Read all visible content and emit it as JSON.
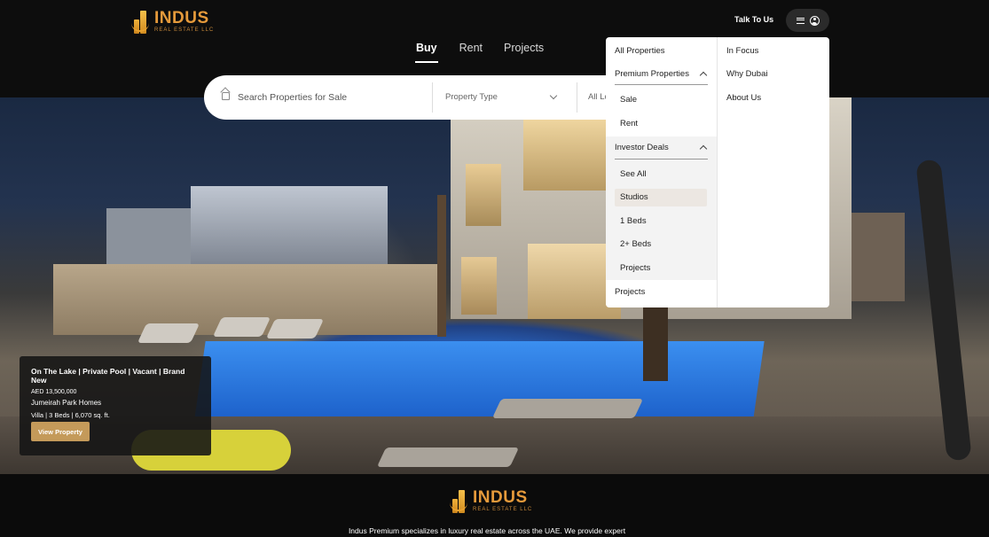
{
  "brand": {
    "name": "INDUS",
    "subtitle": "REAL ESTATE LLC"
  },
  "header": {
    "talk_label": "Talk To Us",
    "menu_icon": "hamburger-icon",
    "user_icon": "user-circle-icon"
  },
  "tabs": [
    {
      "label": "Buy",
      "active": true
    },
    {
      "label": "Rent",
      "active": false
    },
    {
      "label": "Projects",
      "active": false
    }
  ],
  "search": {
    "placeholder": "Search Properties for Sale",
    "property_type": "Property Type",
    "location": "All Locations"
  },
  "menu": {
    "all_properties": "All Properties",
    "premium": {
      "label": "Premium Properties",
      "items": [
        "Sale",
        "Rent"
      ]
    },
    "investor": {
      "label": "Investor Deals",
      "items": [
        "See All",
        "Studios",
        "1 Beds",
        "2+ Beds",
        "Projects"
      ],
      "highlighted": "Studios"
    },
    "projects": "Projects",
    "right": [
      "In Focus",
      "Why Dubai",
      "About Us"
    ]
  },
  "card": {
    "title": "On The Lake | Private Pool | Vacant | Brand New",
    "price": "AED 13,500,000",
    "name": "Jumeirah Park Homes",
    "spec": "Villa | 3 Beds | 6,070 sq. ft.",
    "button": "View Property"
  },
  "footer": {
    "text": "Indus Premium specializes in luxury real estate across the UAE. We provide expert"
  },
  "colors": {
    "accent": "#c49a5a",
    "logo": "#e59a3b",
    "background": "#0b0b0b"
  }
}
